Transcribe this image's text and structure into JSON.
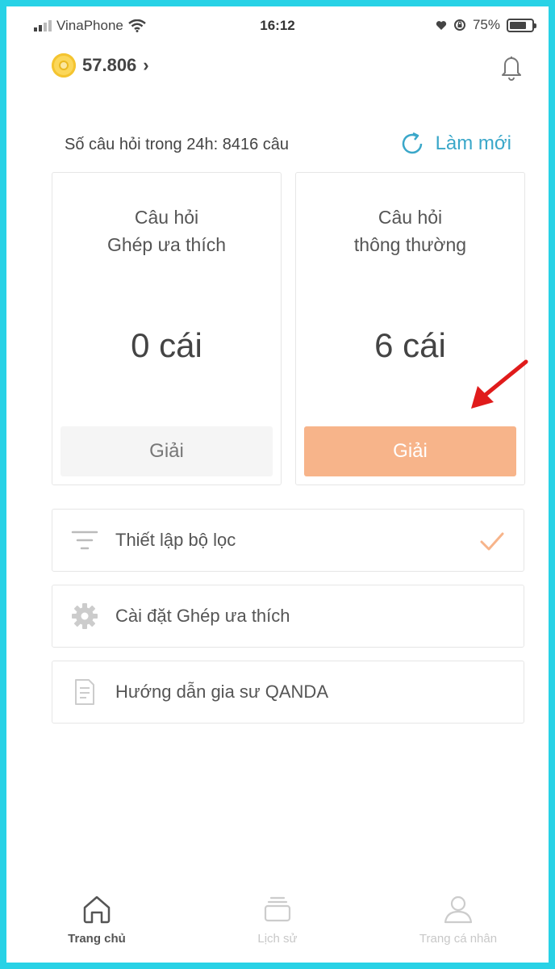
{
  "status_bar": {
    "carrier": "VinaPhone",
    "time": "16:12",
    "battery": "75%",
    "battery_level": 0.75
  },
  "header": {
    "coins": "57.806",
    "coins_chevron": "›"
  },
  "stats": {
    "count_text": "Số câu hỏi trong 24h: 8416 câu",
    "refresh_label": "Làm mới"
  },
  "cards": [
    {
      "title_line1": "Câu hỏi",
      "title_line2": "Ghép ưa thích",
      "count": "0 cái",
      "button": "Giải"
    },
    {
      "title_line1": "Câu hỏi",
      "title_line2": "thông thường",
      "count": "6 cái",
      "button": "Giải"
    }
  ],
  "menu": [
    {
      "label": "Thiết lập bộ lọc",
      "icon": "filter-icon",
      "checked": true
    },
    {
      "label": "Cài đặt Ghép ưa thích",
      "icon": "gear-icon"
    },
    {
      "label": "Hướng dẫn gia sư QANDA",
      "icon": "document-icon"
    }
  ],
  "bottom_nav": [
    {
      "label": "Trang chủ",
      "icon": "home-icon",
      "active": true
    },
    {
      "label": "Lịch sử",
      "icon": "history-icon"
    },
    {
      "label": "Trang cá nhân",
      "icon": "profile-icon"
    }
  ],
  "colors": {
    "frame": "#28d2e6",
    "accent_orange": "#f7b48a",
    "refresh_blue": "#3aa7c9",
    "arrow_red": "#e01b1b"
  }
}
